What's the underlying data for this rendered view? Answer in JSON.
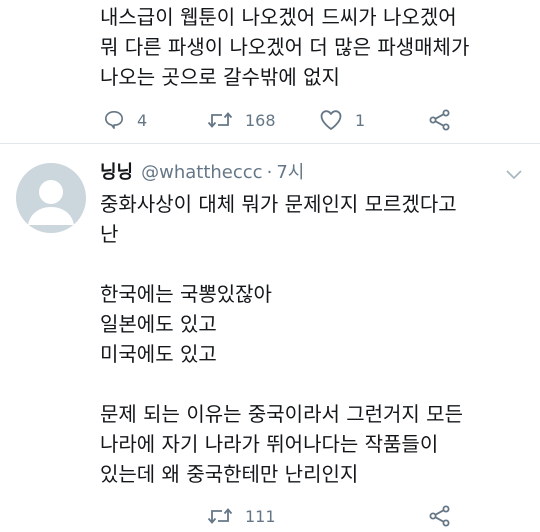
{
  "tweet1": {
    "text": "내스급이 웹툰이 나오겠어 드씨가 나오겠어\n뭐 다른 파생이 나오겠어 더 많은 파생매체가\n나오는 곳으로 갈수밖에 없지",
    "replies": "4",
    "retweets": "168",
    "likes": "1"
  },
  "tweet2": {
    "name": "닝닝",
    "handle": "@whattheccc",
    "separator": "·",
    "time": "7시",
    "text": "중화사상이 대체 뭐가 문제인지 모르겠다고\n난\n\n한국에는 국뽕있잖아\n일본에도 있고\n미국에도 있고\n\n문제 되는 이유는 중국이라서 그런거지 모든\n나라에 자기 나라가 뛰어나다는 작품들이\n있는데 왜 중국한테만 난리인지",
    "retweets": "111"
  },
  "colors": {
    "text": "#14171a",
    "muted": "#657786",
    "avatar": "#ccd6dd",
    "divider": "#e1e8ed"
  },
  "icons": [
    "reply-icon",
    "retweet-icon",
    "like-icon",
    "share-icon",
    "chevron-down-icon"
  ]
}
